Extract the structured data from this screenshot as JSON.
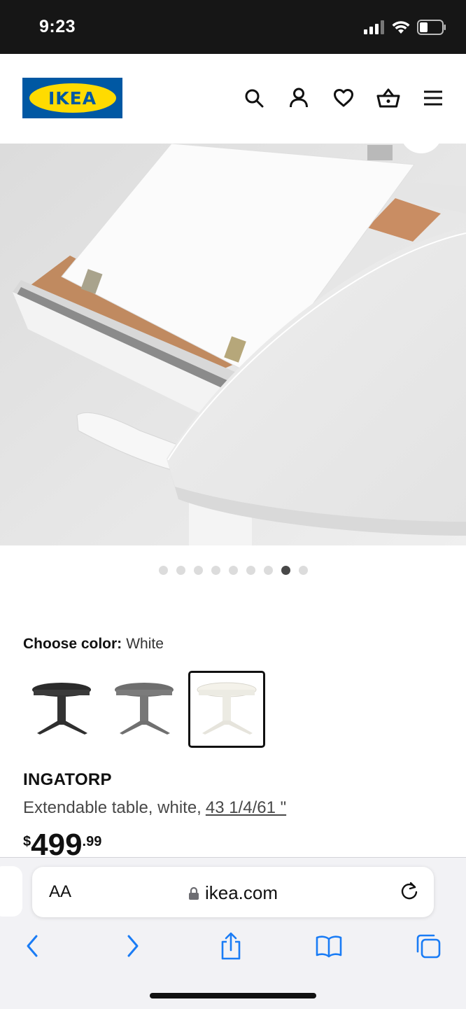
{
  "status_bar": {
    "time": "9:23",
    "icons": [
      "signal-icon",
      "wifi-icon",
      "battery-icon"
    ]
  },
  "header": {
    "logo_text": "IKEA",
    "icons": [
      "search-icon",
      "account-icon",
      "heart-icon",
      "cart-icon",
      "menu-icon"
    ]
  },
  "hero": {
    "image_subject": "extendable-table-leaf-photo"
  },
  "carousel": {
    "total": 9,
    "active_index": 7
  },
  "color_chooser": {
    "label": "Choose color:",
    "value": "White",
    "options": [
      "black-brown",
      "gray",
      "white"
    ],
    "selected": "white"
  },
  "product": {
    "name": "INGATORP",
    "description": "Extendable table, white,",
    "dimensions": "43 1/4/61 \"",
    "price_currency": "$",
    "price_integer": "499",
    "price_decimal": ".99"
  },
  "browser": {
    "aa_label": "AA",
    "url": "ikea.com",
    "toolbar": [
      "back-icon",
      "forward-icon",
      "share-icon",
      "bookmarks-icon",
      "tabs-icon"
    ]
  },
  "colors": {
    "logo_blue": "#0058a3",
    "logo_yellow": "#ffdb00",
    "ios_blue": "#1a7cf5"
  }
}
